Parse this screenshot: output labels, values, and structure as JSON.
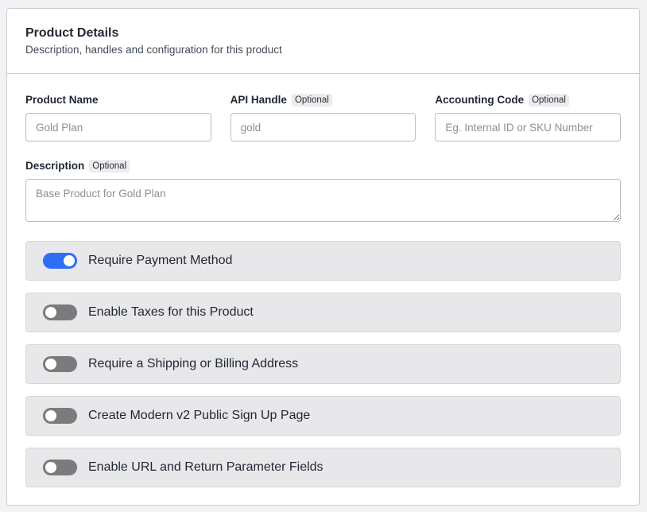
{
  "header": {
    "title": "Product Details",
    "subtitle": "Description, handles and configuration for this product"
  },
  "fields": {
    "product_name": {
      "label": "Product Name",
      "placeholder": "Gold Plan"
    },
    "api_handle": {
      "label": "API Handle",
      "badge": "Optional",
      "placeholder": "gold"
    },
    "accounting_code": {
      "label": "Accounting Code",
      "badge": "Optional",
      "placeholder": "Eg. Internal ID or SKU Number"
    },
    "description": {
      "label": "Description",
      "badge": "Optional",
      "placeholder": "Base Product for Gold Plan"
    }
  },
  "toggles": [
    {
      "label": "Require Payment Method",
      "on": true
    },
    {
      "label": "Enable Taxes for this Product",
      "on": false
    },
    {
      "label": "Require a Shipping or Billing Address",
      "on": false
    },
    {
      "label": "Create Modern v2 Public Sign Up Page",
      "on": false
    },
    {
      "label": "Enable URL and Return Parameter Fields",
      "on": false
    }
  ],
  "colors": {
    "toggle_on": "#2f6df5",
    "toggle_off": "#7b7b7e"
  }
}
